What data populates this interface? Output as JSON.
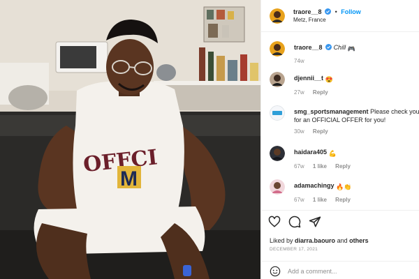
{
  "header": {
    "username": "traore__8",
    "follow_label": "Follow",
    "location": "Metz, France"
  },
  "caption": {
    "username": "traore__8",
    "text": "Chill",
    "emoji": "🎮",
    "time": "74w"
  },
  "comments": [
    {
      "username": "djennii__t",
      "text": "😍",
      "time": "27w",
      "likes": "",
      "reply_label": "Reply"
    },
    {
      "username": "smg_sportsmanagement",
      "text": "Please check your DM for an OFFICIAL OFFER for you!",
      "time": "30w",
      "likes": "",
      "reply_label": "Reply"
    },
    {
      "username": "haidara405",
      "text": "💪",
      "time": "67w",
      "likes": "1 like",
      "reply_label": "Reply"
    },
    {
      "username": "adamachingy",
      "text": "🔥👏",
      "time": "67w",
      "likes": "1 like",
      "reply_label": "Reply"
    }
  ],
  "likes": {
    "prefix": "Liked by",
    "user": "diarra.baouro",
    "and": "and",
    "others": "others"
  },
  "date": "DECEMBER 17, 2021",
  "add_comment": {
    "placeholder": "Add a comment..."
  },
  "icons": {
    "like": "heart-icon",
    "comment": "comment-icon",
    "share": "share-icon",
    "emoji": "smiley-icon",
    "verified": "verified-badge-icon"
  },
  "colors": {
    "link_blue": "#0095f6",
    "secondary_text": "#8e8e8e",
    "border": "#efefef"
  }
}
